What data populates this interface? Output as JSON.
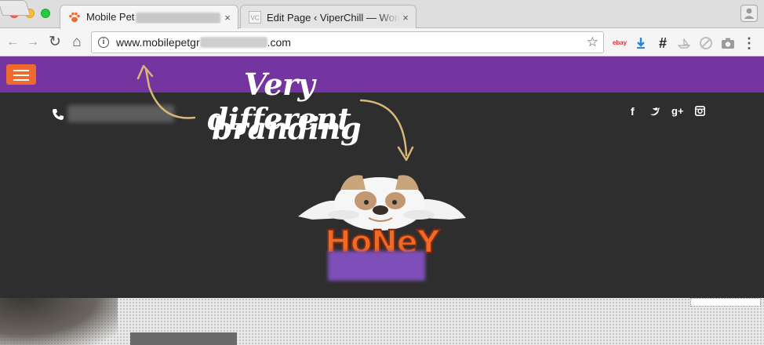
{
  "browser": {
    "tabs": [
      {
        "title": "Mobile Pet",
        "active": true,
        "close": "×"
      },
      {
        "title": "Edit Page ‹ ViperChill — WordP",
        "active": false,
        "close": "×"
      }
    ],
    "address_bar": {
      "url_start": "www.mobilepetgr",
      "url_end": ".com",
      "info_glyph": "i"
    },
    "nav_glyphs": {
      "back": "←",
      "forward": "→",
      "reload": "↻",
      "home": "⌂",
      "star": "☆"
    },
    "extensions": [
      {
        "name": "ebay-extension-icon",
        "text": "ebay"
      },
      {
        "name": "hashtag-extension-icon",
        "text": "#"
      },
      {
        "name": "menu-dots-icon",
        "text": "⋮"
      }
    ]
  },
  "page": {
    "brand_color": "#7535a0",
    "menu_button_color": "#f06a30",
    "social": [
      "f",
      "t",
      "g+",
      "ig"
    ],
    "logo_text": "HoNeY"
  },
  "annotation": {
    "line1": "Very different",
    "line2": "branding",
    "arrow_color": "#d8b878"
  }
}
